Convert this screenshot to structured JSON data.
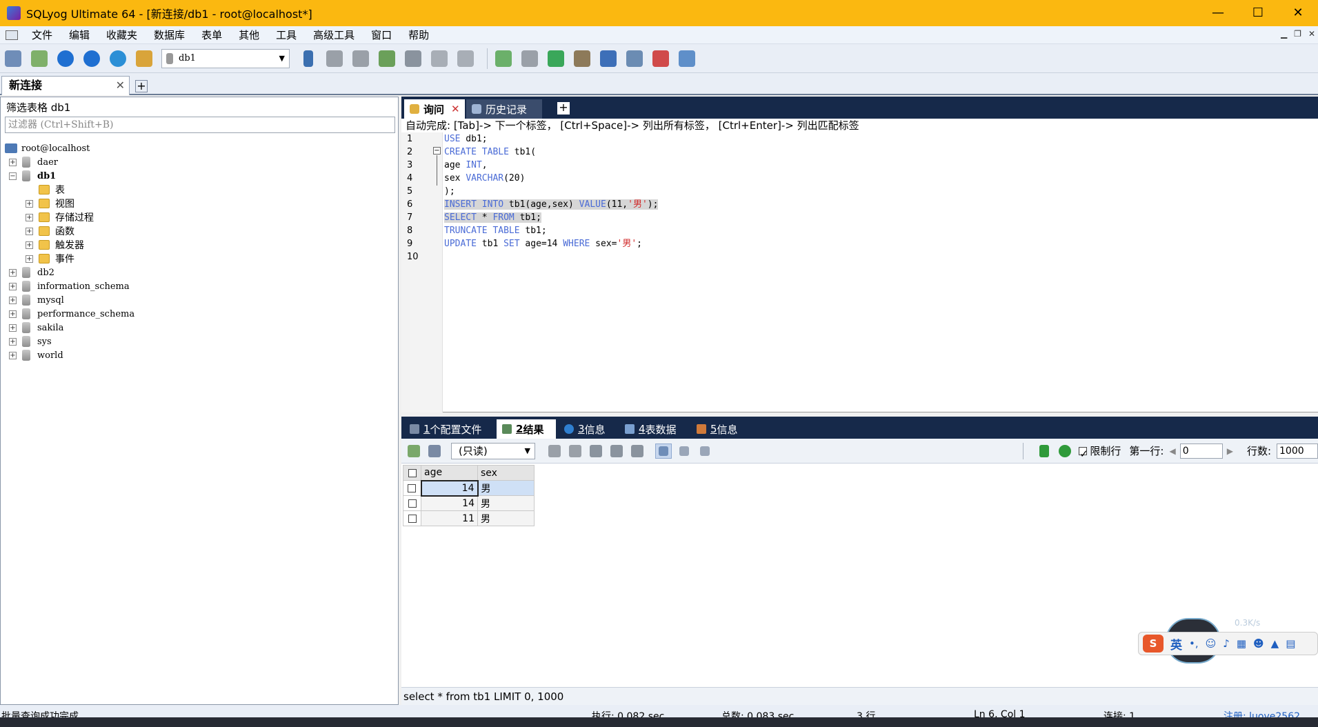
{
  "window": {
    "title": "SQLyog Ultimate 64 - [新连接/db1 - root@localhost*]",
    "minimize": "—",
    "maximize": "☐",
    "close": "✕"
  },
  "menu": [
    "文件",
    "编辑",
    "收藏夹",
    "数据库",
    "表单",
    "其他",
    "工具",
    "高级工具",
    "窗口",
    "帮助"
  ],
  "toolbar": {
    "db_select": "db1"
  },
  "connection_tab": {
    "label": "新连接",
    "close": "✕",
    "add": "+"
  },
  "left": {
    "filter_label": "筛选表格 db1",
    "filter_placeholder": "过滤器 (Ctrl+Shift+B)",
    "root": "root@localhost",
    "databases": [
      "daer",
      "db1",
      "db2",
      "information_schema",
      "mysql",
      "performance_schema",
      "sakila",
      "sys",
      "world"
    ],
    "db1_children": [
      "表",
      "视图",
      "存储过程",
      "函数",
      "触发器",
      "事件"
    ]
  },
  "query_tabs": {
    "query": "询问",
    "history": "历史记录",
    "close": "✕",
    "add": "+"
  },
  "hint": "自动完成:  [Tab]-> 下一个标签，  [Ctrl+Space]-> 列出所有标签，  [Ctrl+Enter]-> 列出匹配标签",
  "editor": {
    "line_numbers": [
      "1",
      "2",
      "3",
      "4",
      "5",
      "6",
      "7",
      "8",
      "9",
      "10"
    ],
    "lines": [
      [
        {
          "t": "USE",
          "c": "kw"
        },
        {
          "t": " db1;"
        }
      ],
      [
        {
          "t": "CREATE TABLE",
          "c": "kw"
        },
        {
          "t": " tb1("
        }
      ],
      [
        {
          "t": "age "
        },
        {
          "t": "INT",
          "c": "kw"
        },
        {
          "t": ","
        }
      ],
      [
        {
          "t": "sex "
        },
        {
          "t": "VARCHAR",
          "c": "kw"
        },
        {
          "t": "(20)"
        }
      ],
      [
        {
          "t": ");"
        }
      ],
      [
        {
          "t": "INSERT INTO",
          "c": "kw sel"
        },
        {
          "t": " tb1(age,sex) ",
          "c": "sel"
        },
        {
          "t": "VALUE",
          "c": "kw sel"
        },
        {
          "t": "(11,",
          "c": "sel"
        },
        {
          "t": "'男'",
          "c": "str sel"
        },
        {
          "t": ");",
          "c": "sel"
        }
      ],
      [
        {
          "t": "SELECT",
          "c": "kw sel"
        },
        {
          "t": " * ",
          "c": "sel"
        },
        {
          "t": "FROM",
          "c": "kw sel"
        },
        {
          "t": " tb1;",
          "c": "sel"
        }
      ],
      [
        {
          "t": "TRUNCATE TABLE",
          "c": "kw"
        },
        {
          "t": " tb1;"
        }
      ],
      [
        {
          "t": "UPDATE",
          "c": "kw"
        },
        {
          "t": " tb1 "
        },
        {
          "t": "SET",
          "c": "kw"
        },
        {
          "t": " age=14 "
        },
        {
          "t": "WHERE",
          "c": "kw"
        },
        {
          "t": " sex="
        },
        {
          "t": "'男'",
          "c": "str"
        },
        {
          "t": ";"
        }
      ],
      []
    ]
  },
  "result_tabs": [
    {
      "num": "1",
      "label": " 个配置文件"
    },
    {
      "num": "2",
      "label": " 结果"
    },
    {
      "num": "3",
      "label": " 信息"
    },
    {
      "num": "4",
      "label": " 表数据"
    },
    {
      "num": "5",
      "label": " 信息"
    }
  ],
  "result_toolbar": {
    "mode": "(只读)",
    "limit_label": "限制行",
    "first_row_label": "第一行:",
    "first_row_value": "0",
    "rows_label": "行数:",
    "rows_value": "1000"
  },
  "grid": {
    "columns": [
      "age",
      "sex"
    ],
    "rows": [
      [
        "14",
        "男"
      ],
      [
        "14",
        "男"
      ],
      [
        "11",
        "男"
      ]
    ]
  },
  "query_status": "select * from tb1 LIMIT 0, 1000",
  "statusbar": {
    "left": "批量查询成功完成",
    "exec": "执行: 0.082 sec",
    "total": "总数: 0.083 sec",
    "rows": "3 行",
    "pos": "Ln 6, Col 1",
    "conn": "连接: 1",
    "reg": "注册: luove2562"
  },
  "ime": {
    "lang": "英",
    "speed": "0.3K/s"
  }
}
